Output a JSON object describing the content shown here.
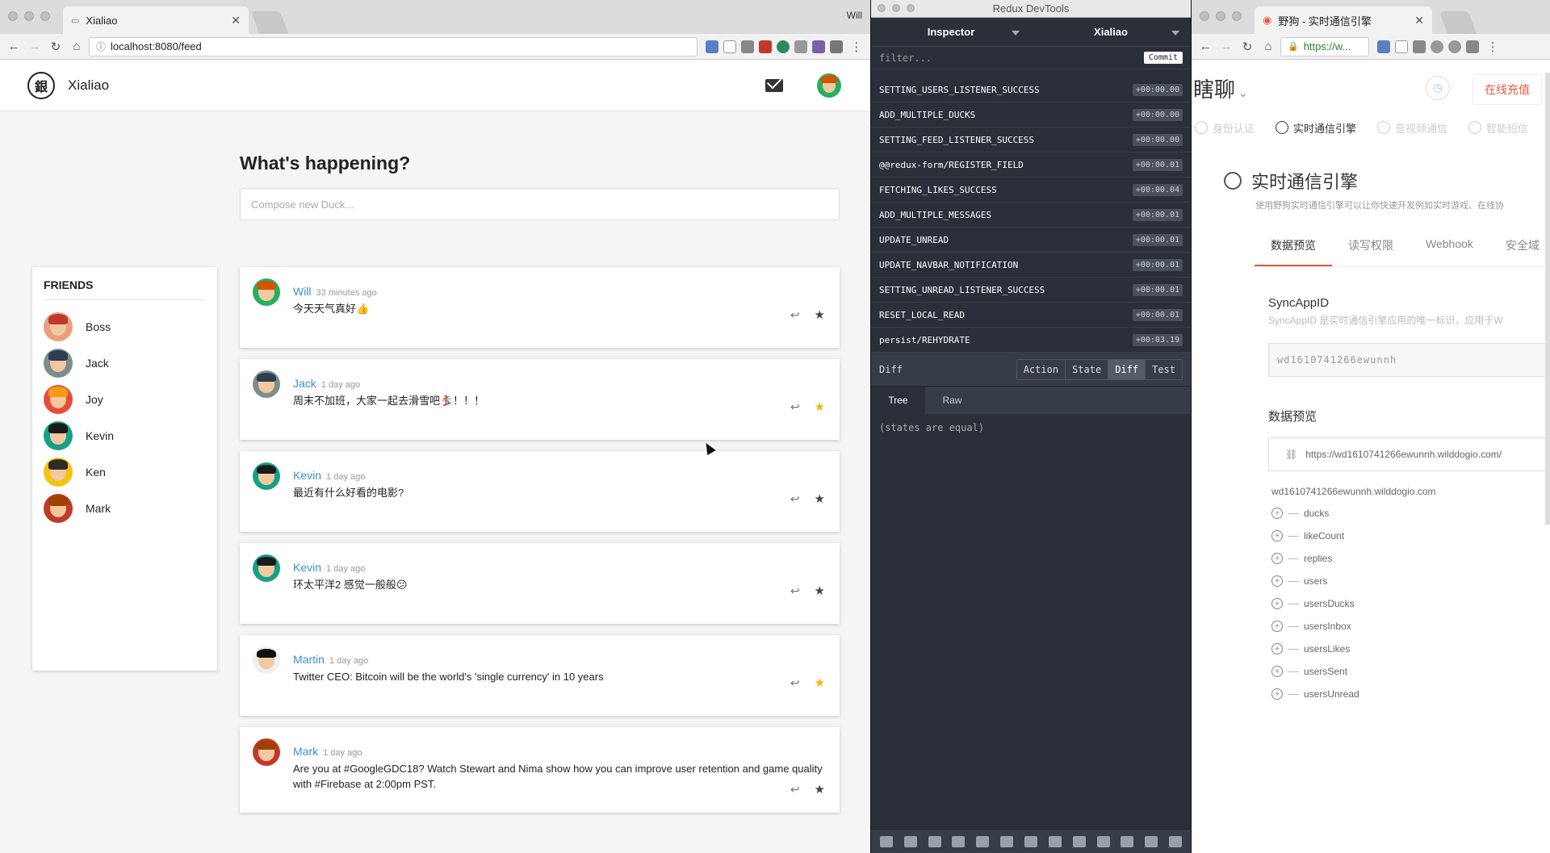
{
  "browser_left": {
    "tab_title": "Xialiao",
    "url": "localhost:8080/feed",
    "profile": "Will"
  },
  "app": {
    "brand": "Xialiao",
    "logo_glyph": "銀",
    "composer_title": "What's happening?",
    "composer_placeholder": "Compose new Duck...",
    "friends_title": "FRIENDS",
    "friends": [
      {
        "name": "Boss",
        "hair": "#c0392b",
        "bg": "#e8a07a"
      },
      {
        "name": "Jack",
        "hair": "#2c3e50",
        "bg": "#7f8c8d"
      },
      {
        "name": "Joy",
        "hair": "#f39c12",
        "bg": "#e74c3c"
      },
      {
        "name": "Kevin",
        "hair": "#1a1a1a",
        "bg": "#16a085"
      },
      {
        "name": "Ken",
        "hair": "#2c2c2c",
        "bg": "#f1c40f"
      },
      {
        "name": "Mark",
        "hair": "#a04000",
        "bg": "#c0392b"
      }
    ],
    "ducks": [
      {
        "author": "Will",
        "time": "33 minutes ago",
        "text": "今天天气真好👍",
        "starred": false,
        "hair": "#d35400",
        "bg": "#27ae60"
      },
      {
        "author": "Jack",
        "time": "1 day ago",
        "text": "周末不加班，大家一起去滑雪吧🏂！！！",
        "starred": true,
        "hair": "#2c3e50",
        "bg": "#7f8c8d"
      },
      {
        "author": "Kevin",
        "time": "1 day ago",
        "text": "最近有什么好看的电影?",
        "starred": false,
        "hair": "#1a1a1a",
        "bg": "#16a085"
      },
      {
        "author": "Kevin",
        "time": "1 day ago",
        "text": "环太平洋2 感觉一般般😕",
        "starred": false,
        "hair": "#1a1a1a",
        "bg": "#16a085"
      },
      {
        "author": "Martin",
        "time": "1 day ago",
        "text": "Twitter CEO: Bitcoin will be the world's 'single currency' in 10 years",
        "starred": true,
        "hair": "#111",
        "bg": "#ecf0f1"
      },
      {
        "author": "Mark",
        "time": "1 day ago",
        "text": "Are you at #GoogleGDC18? Watch Stewart and Nima show how you can improve user retention and game quality with #Firebase at 2:00pm PST.",
        "starred": false,
        "hair": "#a04000",
        "bg": "#c0392b"
      }
    ],
    "accent": "#3b8fd0",
    "star_color": "#f5b400"
  },
  "devtools": {
    "window_title": "Redux DevTools",
    "monitor": "Inspector",
    "instance": "Xialiao",
    "filter_placeholder": "filter...",
    "commit_label": "Commit",
    "actions": [
      {
        "name": "SETTING_USERS_LISTENER_SUCCESS",
        "time": "+00:00.00"
      },
      {
        "name": "ADD_MULTIPLE_DUCKS",
        "time": "+00:00.00"
      },
      {
        "name": "SETTING_FEED_LISTENER_SUCCESS",
        "time": "+00:00.00"
      },
      {
        "name": "@@redux-form/REGISTER_FIELD",
        "time": "+00:00.01"
      },
      {
        "name": "FETCHING_LIKES_SUCCESS",
        "time": "+00:00.04"
      },
      {
        "name": "ADD_MULTIPLE_MESSAGES",
        "time": "+00:00.01"
      },
      {
        "name": "UPDATE_UNREAD",
        "time": "+00:00.01"
      },
      {
        "name": "UPDATE_NAVBAR_NOTIFICATION",
        "time": "+00:00.01"
      },
      {
        "name": "SETTING_UNREAD_LISTENER_SUCCESS",
        "time": "+00:00.01"
      },
      {
        "name": "RESET_LOCAL_READ",
        "time": "+00:00.01"
      },
      {
        "name": "persist/REHYDRATE",
        "time": "+00:03.19"
      }
    ],
    "panel_label": "Diff",
    "panel_buttons": [
      "Action",
      "State",
      "Diff",
      "Test"
    ],
    "active_button": "Diff",
    "subtabs": [
      "Tree",
      "Raw"
    ],
    "content": "(states are equal)"
  },
  "browser_right": {
    "tab_title": "野狗 - 实时通信引擎",
    "url": "https://w...",
    "app_name": "瞎聊",
    "recharge": "在线充值",
    "nav": [
      {
        "label": "身份认证",
        "active": false
      },
      {
        "label": "实时通信引擎",
        "active": true
      },
      {
        "label": "音视频通信",
        "active": false
      },
      {
        "label": "智能短信",
        "active": false
      }
    ],
    "section_title": "实时通信引擎",
    "section_desc": "使用野狗实时通信引擎可以让你快速开发例如实时游戏、在线协",
    "tabs": [
      "数据预览",
      "读写权限",
      "Webhook",
      "安全域"
    ],
    "active_tab": "数据预览",
    "syncappid_label": "SyncAppID",
    "syncappid_desc": "SyncAppID 是实时通信引擎应用的唯一标识，应用于W",
    "syncappid_value": "wd1610741266ewunnh",
    "preview_label": "数据预览",
    "preview_url": "https://wd1610741266ewunnh.wilddogio.com/",
    "tree_root": "wd1610741266ewunnh.wilddogio.com",
    "tree_nodes": [
      "ducks",
      "likeCount",
      "replies",
      "users",
      "usersDucks",
      "usersInbox",
      "usersLikes",
      "usersSent",
      "usersUnread"
    ]
  }
}
